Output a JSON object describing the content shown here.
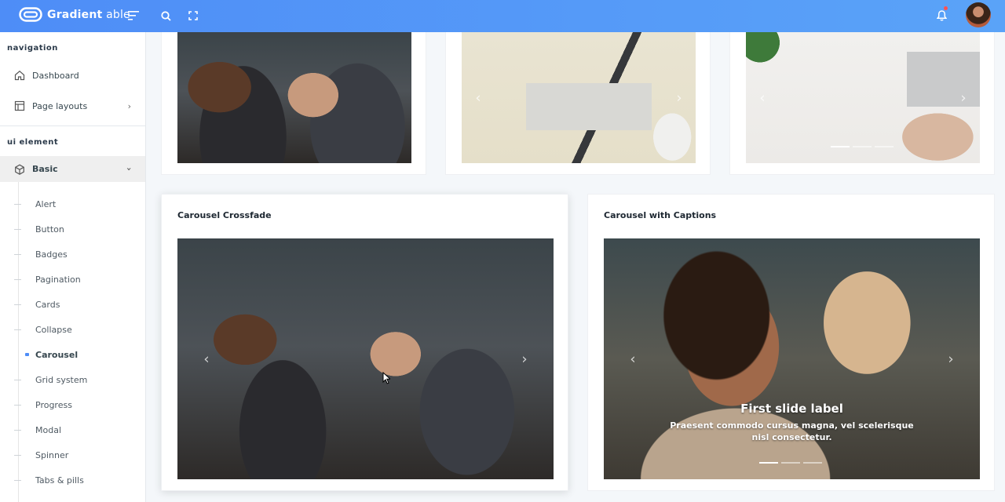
{
  "header": {
    "brand_bold": "Gradient",
    "brand_light": " able",
    "icons": [
      "logo-icon",
      "menu-toggle-icon",
      "search-icon",
      "fullscreen-icon",
      "bell-icon",
      "avatar"
    ],
    "accent": "#4e8df7",
    "notification_dot": "#ff5252"
  },
  "sidebar": {
    "section1": "navigation",
    "items": [
      {
        "label": "Dashboard",
        "icon": "home-icon"
      },
      {
        "label": "Page layouts",
        "icon": "layout-icon"
      }
    ],
    "section2": "ui element",
    "basic": {
      "label": "Basic",
      "icon": "box-icon"
    },
    "sub_items": [
      "Alert",
      "Button",
      "Badges",
      "Pagination",
      "Cards",
      "Collapse",
      "Carousel",
      "Grid system",
      "Progress",
      "Modal",
      "Spinner",
      "Tabs & pills"
    ],
    "active_sub_item": "Carousel"
  },
  "main": {
    "crossfade": {
      "title": "Carousel Crossfade"
    },
    "captions": {
      "title": "Carousel with Captions",
      "slide_label": "First slide label",
      "slide_text": "Praesent commodo cursus magna, vel scelerisque nisl consectetur."
    }
  }
}
